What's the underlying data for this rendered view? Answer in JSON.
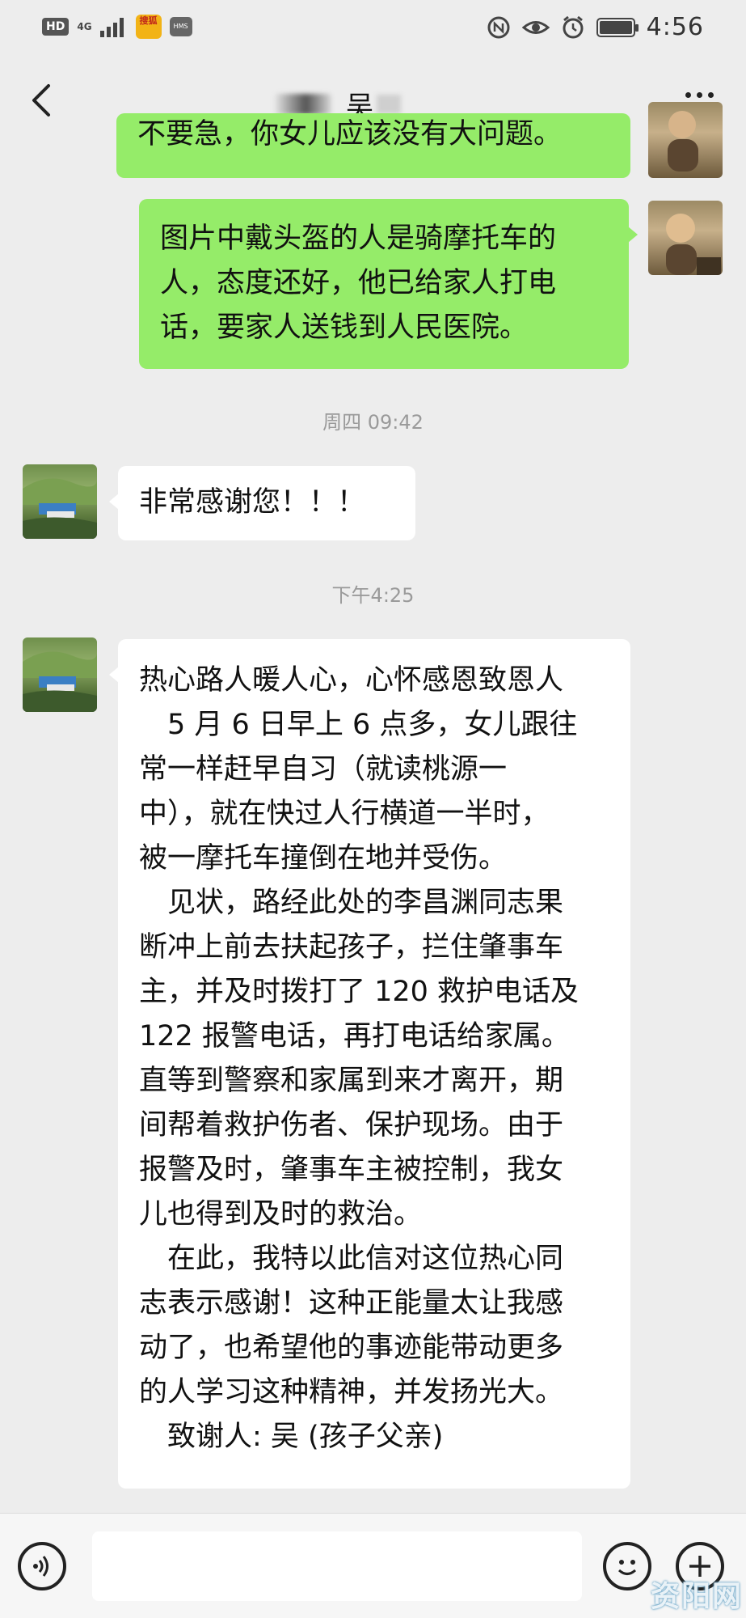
{
  "status_bar": {
    "hd": "HD",
    "network": "4G",
    "app_badge": "搜狐",
    "small_badge": "HMS",
    "time": "4:56",
    "icons": [
      "signal-icon",
      "nfc-icon",
      "eye-icon",
      "alarm-icon",
      "battery-icon"
    ]
  },
  "header": {
    "title": "吴",
    "back_icon": "chevron-left-icon",
    "more_icon": "more-dots-icon"
  },
  "messages": [
    {
      "side": "right",
      "text": "不要急，你女儿应该没有大问题。"
    },
    {
      "side": "right",
      "lines": [
        "图片中戴头盔的人是骑摩托车的",
        "人，态度还好，他已给家人打电",
        "话，要家人送钱到人民医院。"
      ]
    },
    {
      "side": "left",
      "text": "非常感谢您！！！"
    },
    {
      "side": "left",
      "lines": [
        "热心路人暖人心，心怀感恩致恩人",
        "5 月 6 日早上 6 点多，女儿跟往",
        "常一样赶早自习（就读桃源一",
        "中），就在快过人行横道一半时，",
        "被一摩托车撞倒在地并受伤。",
        "见状，路经此处的李昌渊同志果",
        "断冲上前去扶起孩子，拦住肇事车",
        "主，并及时拨打了 120 救护电话及",
        "122 报警电话，再打电话给家属。",
        "直等到警察和家属到来才离开，期",
        "间帮着救护伤者、保护现场。由于",
        "报警及时，肇事车主被控制，我女",
        "儿也得到及时的救治。",
        "在此，我特以此信对这位热心同",
        "志表示感谢！这种正能量太让我感",
        "动了，也希望他的事迹能带动更多",
        "的人学习这种精神，并发扬光大。",
        "致谢人: 吴      (孩子父亲)"
      ]
    }
  ],
  "timestamps": [
    "周四 09:42",
    "下午4:25"
  ],
  "input_bar": {
    "voice_icon": "voice-icon",
    "emoji_icon": "emoji-icon",
    "plus_icon": "plus-icon",
    "value": ""
  },
  "watermark": "资阳网"
}
